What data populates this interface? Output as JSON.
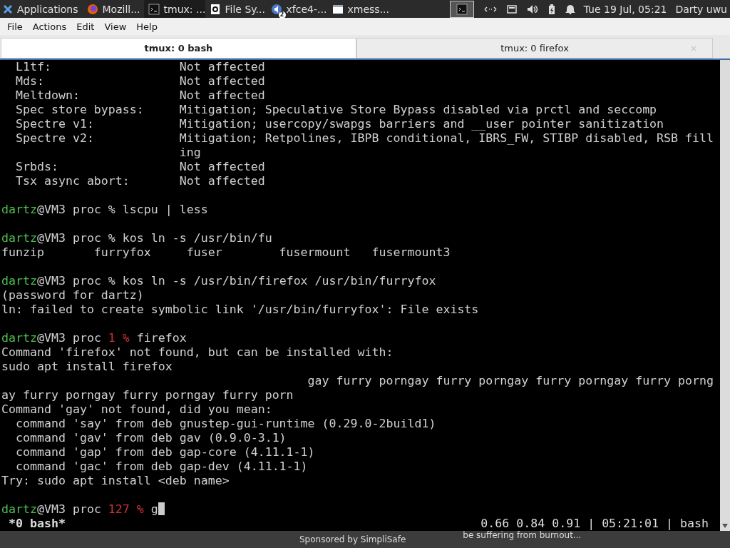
{
  "panel": {
    "apps_label": "Applications",
    "tasks": [
      {
        "kind": "browser",
        "label": "Mozill...",
        "selected": false
      },
      {
        "kind": "terminal",
        "label": "tmux: ...",
        "selected": true
      },
      {
        "kind": "files",
        "label": "File Sy...",
        "selected": false
      },
      {
        "kind": "mixer",
        "label": "xfce4-...",
        "badge": "2",
        "selected": false
      },
      {
        "kind": "window",
        "label": "xmess...",
        "selected": false
      }
    ],
    "clock": "Tue 19 Jul, 05:21",
    "user": "Darty uwu"
  },
  "menu": [
    "File",
    "Actions",
    "Edit",
    "View",
    "Help"
  ],
  "tabs": [
    {
      "label": "tmux: 0 bash",
      "selected": true
    },
    {
      "label": "tmux: 0 firefox",
      "selected": false
    }
  ],
  "terminal": {
    "lines": [
      {
        "text": "  L1tf:                  Not affected"
      },
      {
        "text": "  Mds:                   Not affected"
      },
      {
        "text": "  Meltdown:              Not affected"
      },
      {
        "text": "  Spec store bypass:     Mitigation; Speculative Store Bypass disabled via prctl and seccomp"
      },
      {
        "text": "  Spectre v1:            Mitigation; usercopy/swapgs barriers and __user pointer sanitization"
      },
      {
        "text": "  Spectre v2:            Mitigation; Retpolines, IBPB conditional, IBRS_FW, STIBP disabled, RSB fill"
      },
      {
        "text": "                         ing"
      },
      {
        "text": "  Srbds:                 Not affected"
      },
      {
        "text": "  Tsx async abort:       Not affected"
      },
      {
        "kind": "blank"
      },
      {
        "kind": "prompt",
        "user": "dartz",
        "location": "@VM3 proc",
        "symbol": "%",
        "command": "lscpu | less"
      },
      {
        "kind": "blank"
      },
      {
        "kind": "prompt",
        "user": "dartz",
        "location": "@VM3 proc",
        "symbol": "%",
        "command": "kos ln -s /usr/bin/fu"
      },
      {
        "text": "funzip       furryfox     fuser        fusermount   fusermount3"
      },
      {
        "kind": "blank"
      },
      {
        "kind": "prompt",
        "user": "dartz",
        "location": "@VM3 proc",
        "symbol": "%",
        "command": "kos ln -s /usr/bin/firefox /usr/bin/furryfox"
      },
      {
        "text": "(password for dartz)"
      },
      {
        "text": "ln: failed to create symbolic link '/usr/bin/furryfox': File exists"
      },
      {
        "kind": "blank"
      },
      {
        "kind": "prompt",
        "user": "dartz",
        "location": "@VM3 proc",
        "code": "1",
        "symbol": "%",
        "command": "firefox"
      },
      {
        "text": "Command 'firefox' not found, but can be installed with:"
      },
      {
        "text": "sudo apt install firefox"
      },
      {
        "text": "                                           gay furry porngay furry porngay furry porngay furry porng"
      },
      {
        "text": "ay furry porngay furry porngay furry porn"
      },
      {
        "text": "Command 'gay' not found, did you mean:"
      },
      {
        "text": "  command 'say' from deb gnustep-gui-runtime (0.29.0-2build1)"
      },
      {
        "text": "  command 'gav' from deb gav (0.9.0-3.1)"
      },
      {
        "text": "  command 'gap' from deb gap-core (4.11.1-1)"
      },
      {
        "text": "  command 'gac' from deb gap-dev (4.11.1-1)"
      },
      {
        "text": "Try: sudo apt install <deb name>"
      },
      {
        "kind": "blank"
      },
      {
        "kind": "prompt",
        "user": "dartz",
        "location": "@VM3 proc",
        "code": "127",
        "symbol": "%",
        "command": "g",
        "cursor": true
      }
    ],
    "status_left": "*0 bash*",
    "status_right": "0.66 0.84 0.91 | 05:21:01 | bash"
  },
  "bottom": {
    "sponsor": "Sponsored by SimpliSafe",
    "caption": "be suffering from burnout..."
  }
}
